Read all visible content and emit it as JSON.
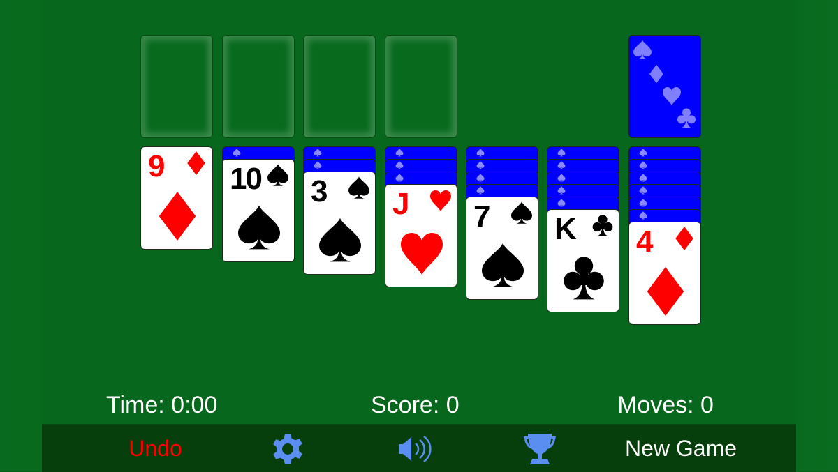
{
  "foundations": [
    {
      "label": "foundation-1",
      "empty": true
    },
    {
      "label": "foundation-2",
      "empty": true
    },
    {
      "label": "foundation-3",
      "empty": true
    },
    {
      "label": "foundation-4",
      "empty": true
    }
  ],
  "stock": {
    "face_down": true,
    "suits_on_back": [
      "spade",
      "diamond",
      "heart",
      "club"
    ]
  },
  "tableau": [
    {
      "hidden": 0,
      "card": {
        "rank": "9",
        "suit": "diamond",
        "color": "red"
      }
    },
    {
      "hidden": 1,
      "card": {
        "rank": "10",
        "suit": "spade",
        "color": "black"
      }
    },
    {
      "hidden": 2,
      "card": {
        "rank": "3",
        "suit": "spade",
        "color": "black"
      }
    },
    {
      "hidden": 3,
      "card": {
        "rank": "J",
        "suit": "heart",
        "color": "red"
      }
    },
    {
      "hidden": 4,
      "card": {
        "rank": "7",
        "suit": "spade",
        "color": "black"
      }
    },
    {
      "hidden": 5,
      "card": {
        "rank": "K",
        "suit": "club",
        "color": "black"
      }
    },
    {
      "hidden": 6,
      "card": {
        "rank": "4",
        "suit": "diamond",
        "color": "red"
      }
    }
  ],
  "stats": {
    "time": "Time: 0:00",
    "score": "Score: 0",
    "moves": "Moves: 0"
  },
  "toolbar": {
    "undo_label": "Undo",
    "settings_icon": "gear-icon",
    "sound_icon": "speaker-icon",
    "trophy_icon": "trophy-icon",
    "new_game_label": "New Game"
  },
  "colors": {
    "felt": "#07671c",
    "toolbar_bg": "#063e0c",
    "card_back": "#0000ff",
    "red_suit": "#ff0000",
    "icon_blue": "#5a8ef0",
    "undo_red": "#ff0000"
  }
}
